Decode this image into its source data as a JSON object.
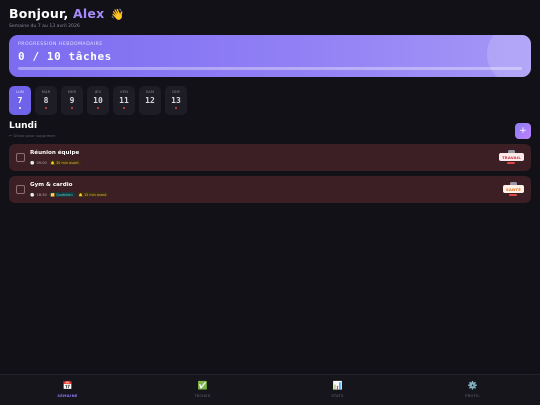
{
  "header": {
    "greeting": "Bonjour,",
    "name": "Alex",
    "wave": "👋",
    "subtitle": "Semaine du 7 au 13 avril 2026"
  },
  "progress": {
    "label": "PROGRESSION HEBDOMADAIRE",
    "count_text": "0 / 10 tâches",
    "done": 0,
    "total": 10
  },
  "days": [
    {
      "name": "LUN",
      "num": "7",
      "active": true,
      "dot": true
    },
    {
      "name": "MAR",
      "num": "8",
      "active": false,
      "dot": true
    },
    {
      "name": "MER",
      "num": "9",
      "active": false,
      "dot": true
    },
    {
      "name": "JEU",
      "num": "10",
      "active": false,
      "dot": true
    },
    {
      "name": "VEN",
      "num": "11",
      "active": false,
      "dot": true
    },
    {
      "name": "SAM",
      "num": "12",
      "active": false,
      "dot": false
    },
    {
      "name": "DIM",
      "num": "13",
      "active": false,
      "dot": true
    }
  ],
  "section": {
    "title": "Lundi",
    "hint": "← Glisse pour supprimer",
    "add_label": "+"
  },
  "tasks": [
    {
      "title": "Réunion équipe",
      "time": "09:00",
      "alert": "🔔 30 min avant",
      "repeat": "",
      "tag": "TRAVAIL"
    },
    {
      "title": "Gym & cardio",
      "time": "18:30",
      "alert": "🔔 15 min avant",
      "repeat": "🔁 Quotidien",
      "tag": "SANTÉ"
    }
  ],
  "nav": [
    {
      "icon": "📅",
      "label": "SEMAINE",
      "active": true
    },
    {
      "icon": "✅",
      "label": "TÂCHES",
      "active": false
    },
    {
      "icon": "📊",
      "label": "STATS",
      "active": false
    },
    {
      "icon": "⚙️",
      "label": "PROFIL",
      "active": false
    }
  ],
  "colors": {
    "accent": "#8b7cf6",
    "background": "#121118",
    "task_bg": "#3b1f25"
  }
}
